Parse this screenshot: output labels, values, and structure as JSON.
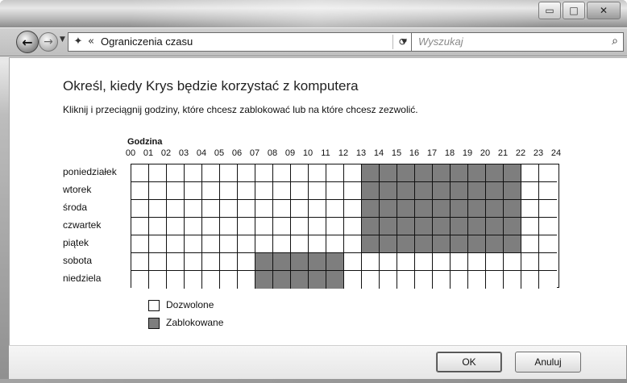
{
  "window": {
    "controls": {
      "minimize_icon": "minimize-icon",
      "maximize_icon": "maximize-icon",
      "close_icon": "close-icon"
    }
  },
  "nav": {
    "address_text": "Ograniczenia czasu",
    "address_prefix": "«",
    "search_placeholder": "Wyszukaj",
    "refresh_symbol": "⟳"
  },
  "main": {
    "heading": "Określ, kiedy Krys będzie korzystać z komputera",
    "instruction": "Kliknij i przeciągnij godziny, które chcesz zablokować lub na które chcesz zezwolić.",
    "grid_title": "Godzina",
    "hours": [
      "00",
      "01",
      "02",
      "03",
      "04",
      "05",
      "06",
      "07",
      "08",
      "09",
      "10",
      "11",
      "12",
      "13",
      "14",
      "15",
      "16",
      "17",
      "18",
      "19",
      "20",
      "21",
      "22",
      "23",
      "24"
    ],
    "days": [
      "poniedziałek",
      "wtorek",
      "środa",
      "czwartek",
      "piątek",
      "sobota",
      "niedziela"
    ],
    "blocked": [
      [
        0,
        0,
        0,
        0,
        0,
        0,
        0,
        0,
        0,
        0,
        0,
        0,
        0,
        1,
        1,
        1,
        1,
        1,
        1,
        1,
        1,
        1,
        0,
        0
      ],
      [
        0,
        0,
        0,
        0,
        0,
        0,
        0,
        0,
        0,
        0,
        0,
        0,
        0,
        1,
        1,
        1,
        1,
        1,
        1,
        1,
        1,
        1,
        0,
        0
      ],
      [
        0,
        0,
        0,
        0,
        0,
        0,
        0,
        0,
        0,
        0,
        0,
        0,
        0,
        1,
        1,
        1,
        1,
        1,
        1,
        1,
        1,
        1,
        0,
        0
      ],
      [
        0,
        0,
        0,
        0,
        0,
        0,
        0,
        0,
        0,
        0,
        0,
        0,
        0,
        1,
        1,
        1,
        1,
        1,
        1,
        1,
        1,
        1,
        0,
        0
      ],
      [
        0,
        0,
        0,
        0,
        0,
        0,
        0,
        0,
        0,
        0,
        0,
        0,
        0,
        1,
        1,
        1,
        1,
        1,
        1,
        1,
        1,
        1,
        0,
        0
      ],
      [
        0,
        0,
        0,
        0,
        0,
        0,
        0,
        1,
        1,
        1,
        1,
        1,
        0,
        0,
        0,
        0,
        0,
        0,
        0,
        0,
        0,
        0,
        0,
        0
      ],
      [
        0,
        0,
        0,
        0,
        0,
        0,
        0,
        1,
        1,
        1,
        1,
        1,
        0,
        0,
        0,
        0,
        0,
        0,
        0,
        0,
        0,
        0,
        0,
        0
      ]
    ],
    "legend": {
      "allowed": "Dozwolone",
      "blocked": "Zablokowane"
    }
  },
  "buttons": {
    "ok": "OK",
    "cancel": "Anuluj"
  },
  "colors": {
    "blocked_cell": "#7e7e7e",
    "allowed_cell": "#ffffff"
  }
}
